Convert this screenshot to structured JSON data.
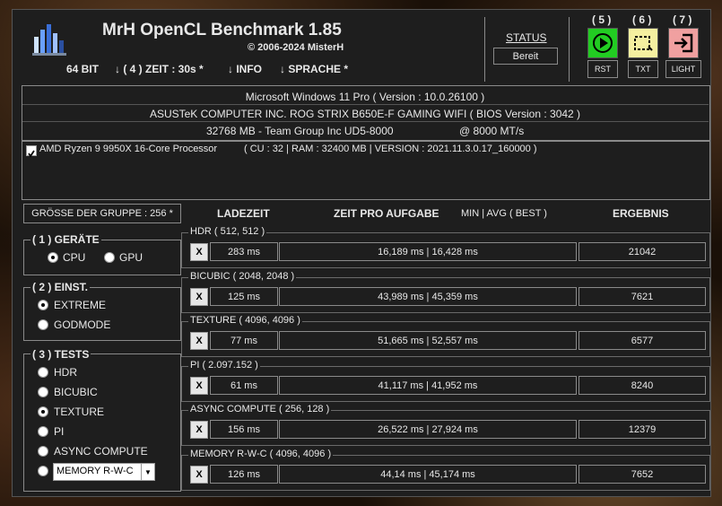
{
  "header": {
    "title": "MrH OpenCL Benchmark 1.85",
    "copyright": "© 2006-2024 MisterH",
    "bits": "64 BIT",
    "zeit": "↓ ( 4 ) ZEIT : 30s *",
    "info": "↓ INFO",
    "sprache": "↓ SPRACHE *",
    "status_label": "STATUS",
    "status_value": "Bereit"
  },
  "toolbar": {
    "rst_num": "( 5 )",
    "rst_label": "RST",
    "txt_num": "( 6 )",
    "txt_label": "TXT",
    "light_num": "( 7 )",
    "light_label": "LIGHT"
  },
  "system": {
    "os": "Microsoft Windows 11 Pro ( Version : 10.0.26100 )",
    "board": "ASUSTeK COMPUTER INC. ROG STRIX B650E-F GAMING WIFI ( BIOS Version : 3042 )",
    "memory": "32768 MB - Team Group Inc UD5-8000",
    "memory_speed": "@ 8000 MT/s",
    "device_name": "AMD Ryzen 9 9950X 16-Core Processor",
    "device_info": "( CU : 32 | RAM : 32400 MB | VERSION : 2021.11.3.0.17_160000 )"
  },
  "group_size": "GRÖSSE DER GRUPPE : 256 *",
  "columns": {
    "ladezeit": "LADEZEIT",
    "zeit": "ZEIT PRO AUFGABE",
    "minavg": "MIN | AVG ( BEST )",
    "ergebnis": "ERGEBNIS"
  },
  "geraete": {
    "title": "( 1 ) GERÄTE",
    "cpu": "CPU",
    "gpu": "GPU"
  },
  "einst": {
    "title": "( 2 ) EINST.",
    "extreme": "EXTREME",
    "godmode": "GODMODE"
  },
  "tests": {
    "title": "( 3 ) TESTS",
    "hdr": "HDR",
    "bicubic": "BICUBIC",
    "texture": "TEXTURE",
    "pi": "PI",
    "async": "ASYNC COMPUTE",
    "memory_select": "MEMORY R-W-C"
  },
  "results": [
    {
      "title": "HDR ( 512, 512 )",
      "x": "X",
      "load": "283 ms",
      "times": "16,189 ms | 16,428 ms",
      "score": "21042"
    },
    {
      "title": "BICUBIC ( 2048, 2048 )",
      "x": "X",
      "load": "125 ms",
      "times": "43,989 ms | 45,359 ms",
      "score": "7621"
    },
    {
      "title": "TEXTURE ( 4096, 4096 )",
      "x": "X",
      "load": "77 ms",
      "times": "51,665 ms | 52,557 ms",
      "score": "6577"
    },
    {
      "title": "PI ( 2.097.152 )",
      "x": "X",
      "load": "61 ms",
      "times": "41,117 ms | 41,952 ms",
      "score": "8240"
    },
    {
      "title": "ASYNC COMPUTE ( 256, 128 )",
      "x": "X",
      "load": "156 ms",
      "times": "26,522 ms | 27,924 ms",
      "score": "12379"
    },
    {
      "title": "MEMORY R-W-C ( 4096, 4096 )",
      "x": "X",
      "load": "126 ms",
      "times": "44,14 ms | 45,174 ms",
      "score": "7652"
    }
  ],
  "colors": {
    "rst": "#22cc22",
    "txt": "#f5f0a0",
    "light": "#f0a0a0"
  }
}
